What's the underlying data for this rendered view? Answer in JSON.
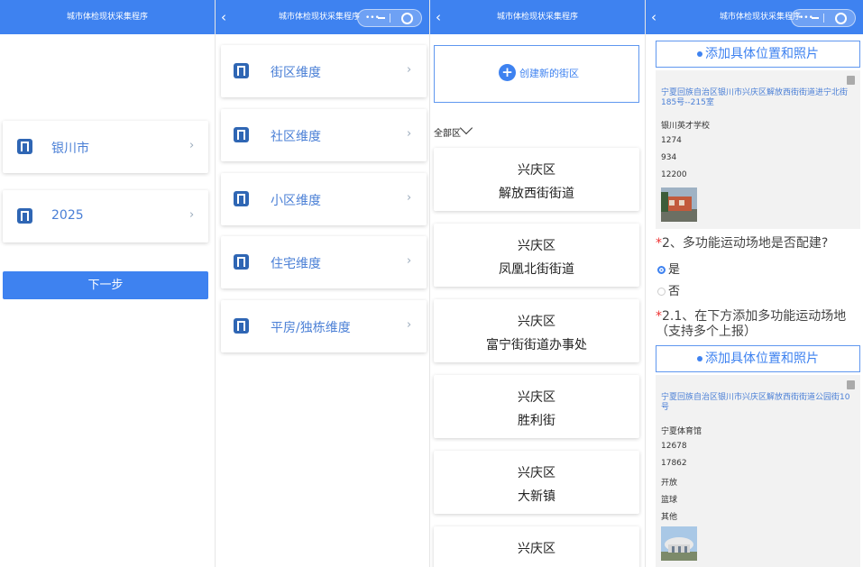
{
  "app_title": "城市体检现状采集程序",
  "panel1": {
    "items": [
      {
        "label": "银川市"
      },
      {
        "label": "2025"
      }
    ],
    "next_button": "下一步"
  },
  "panel2": {
    "items": [
      {
        "label": "街区维度"
      },
      {
        "label": "社区维度"
      },
      {
        "label": "小区维度"
      },
      {
        "label": "住宅维度"
      },
      {
        "label": "平房/独栋维度"
      }
    ]
  },
  "panel3": {
    "create_label": "创建新的街区",
    "filter_label": "全部区",
    "districts": [
      {
        "line1": "兴庆区",
        "line2": "解放西街街道"
      },
      {
        "line1": "兴庆区",
        "line2": "凤凰北街街道"
      },
      {
        "line1": "兴庆区",
        "line2": "富宁街街道办事处"
      },
      {
        "line1": "兴庆区",
        "line2": "胜利街"
      },
      {
        "line1": "兴庆区",
        "line2": "大新镇"
      },
      {
        "line1": "兴庆区",
        "line2": ""
      }
    ]
  },
  "panel4": {
    "add_location_label": "添加具体位置和照片",
    "record1": {
      "address": "宁夏回族自治区银川市兴庆区解放西街街道进宁北街185号--215室",
      "values": [
        "银川英才学校",
        "1274",
        "934",
        "12200"
      ]
    },
    "question2": {
      "number": "2、",
      "text": "多功能运动场地是否配建?",
      "options": [
        {
          "label": "是",
          "selected": true
        },
        {
          "label": "否",
          "selected": false
        }
      ]
    },
    "question21": {
      "number": "2.1、",
      "text": "在下方添加多功能运动场地（支持多个上报）"
    },
    "record2": {
      "address": "宁夏回族自治区银川市兴庆区解放西街街道公园街10号",
      "values": [
        "宁夏体育馆",
        "12678",
        "17862",
        "开放",
        "篮球",
        "其他"
      ]
    }
  },
  "colors": {
    "primary": "#3e82f0",
    "link": "#4a7fd6",
    "required": "#e33333",
    "icon": "#2f66b4"
  },
  "icons": [
    "building-icon",
    "chevron-right-icon",
    "back-icon",
    "plus-circle-icon",
    "chevron-down-icon",
    "trash-icon",
    "more-icon",
    "minimize-icon",
    "close-circle-icon"
  ]
}
